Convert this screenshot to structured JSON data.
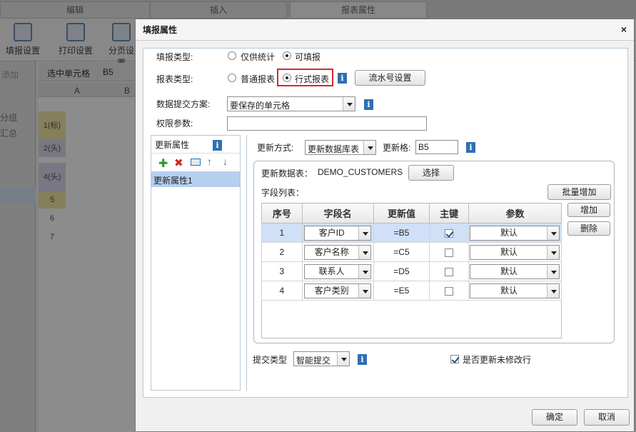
{
  "bg": {
    "tabs": [
      "编辑",
      "插入",
      "报表属性"
    ],
    "toolbar": [
      "填报设置",
      "打印设置",
      "分页设置"
    ],
    "selected_cell_label": "选中单元格",
    "selected_cell_value": "B5",
    "add_label": "添加",
    "col_headers": [
      "A",
      "B"
    ],
    "rows": [
      "1(标)",
      "2(头)",
      "4(头)",
      "5",
      "6",
      "7"
    ],
    "side_items": [
      "分组",
      "汇总"
    ]
  },
  "dialog": {
    "title": "填报属性",
    "close": "×",
    "fill_type_label": "填报类型:",
    "fill_type_options": [
      "仅供统计",
      "可填报"
    ],
    "report_type_label": "报表类型:",
    "report_type_options": [
      "普通报表",
      "行式报表"
    ],
    "serial_button": "流水号设置",
    "submit_scheme_label": "数据提交方案:",
    "submit_scheme_value": "要保存的单元格",
    "permission_label": "权限参数:",
    "permission_value": "",
    "update_attr_header": "更新属性",
    "update_attr_items": [
      "更新属性1"
    ],
    "update_mode_label": "更新方式:",
    "update_mode_value": "更新数据库表",
    "update_cell_label": "更新格:",
    "update_cell_value": "B5",
    "update_table_label": "更新数据表：",
    "update_table_value": "DEMO_CUSTOMERS",
    "select_button": "选择",
    "field_list_label": "字段列表：",
    "batch_add_button": "批量增加",
    "add_button": "增加",
    "delete_button": "删除",
    "columns": [
      "序号",
      "字段名",
      "更新值",
      "主键",
      "参数"
    ],
    "rows": [
      {
        "idx": "1",
        "field": "客户ID",
        "value": "=B5",
        "key": true,
        "param": "默认"
      },
      {
        "idx": "2",
        "field": "客户名称",
        "value": "=C5",
        "key": false,
        "param": "默认"
      },
      {
        "idx": "3",
        "field": "联系人",
        "value": "=D5",
        "key": false,
        "param": "默认"
      },
      {
        "idx": "4",
        "field": "客户类别",
        "value": "=E5",
        "key": false,
        "param": "默认"
      }
    ],
    "submit_type_label": "提交类型",
    "submit_type_value": "智能提交",
    "update_unmodified_label": "是否更新未修改行",
    "update_unmodified_checked": true,
    "ok_button": "确定",
    "cancel_button": "取消",
    "highlight_color": "#d9262b",
    "info_color": "#2f6fb3"
  }
}
